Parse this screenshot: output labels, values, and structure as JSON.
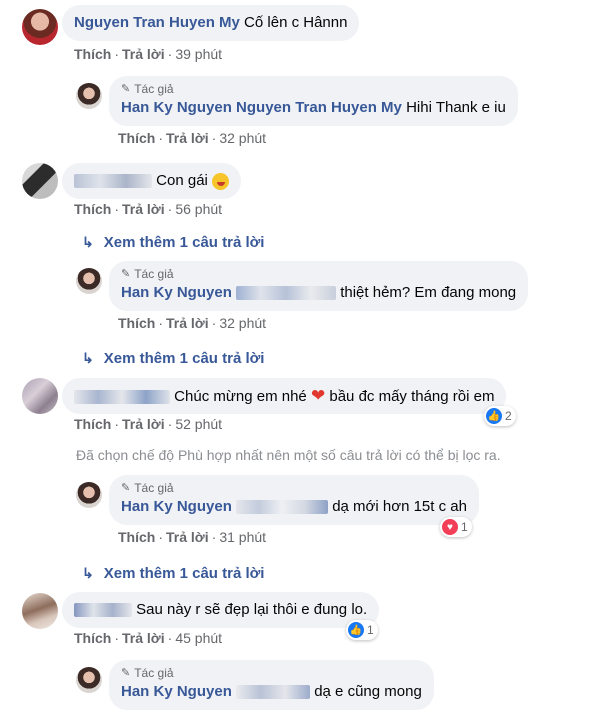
{
  "comments": [
    {
      "author": "Nguyen Tran Huyen My",
      "text": "Cố lên c Hânnn",
      "like": "Thích",
      "reply": "Trả lời",
      "time": "39 phút"
    },
    {
      "author_tag": "Tác giả",
      "author": "Han Ky Nguyen",
      "mention": "Nguyen Tran Huyen My",
      "text": "Hihi Thank e iu",
      "like": "Thích",
      "reply": "Trả lời",
      "time": "32 phút"
    },
    {
      "text": "Con gái",
      "like": "Thích",
      "reply": "Trả lời",
      "time": "56 phút",
      "more": "Xem thêm 1 câu trả lời"
    },
    {
      "author_tag": "Tác giả",
      "author": "Han Ky Nguyen",
      "text": "thiệt hẻm? Em đang mong",
      "like": "Thích",
      "reply": "Trả lời",
      "time": "32 phút",
      "more": "Xem thêm 1 câu trả lời"
    },
    {
      "text_a": "Chúc mừng em nhé",
      "text_b": "bầu đc mấy tháng rồi em",
      "like": "Thích",
      "reply": "Trả lời",
      "time": "52 phút",
      "reaction_count": "2"
    },
    {
      "filter_note": "Đã chọn chế độ Phù hợp nhất nên một số câu trả lời có thể bị lọc ra."
    },
    {
      "author_tag": "Tác giả",
      "author": "Han Ky Nguyen",
      "text": "dạ mới hơn 15t c ah",
      "like": "Thích",
      "reply": "Trả lời",
      "time": "31 phút",
      "reaction_count": "1",
      "more": "Xem thêm 1 câu trả lời"
    },
    {
      "text": "Sau này r sẽ đẹp lại thôi e đung lo.",
      "like": "Thích",
      "reply": "Trả lời",
      "time": "45 phút",
      "reaction_count": "1"
    },
    {
      "author_tag": "Tác giả",
      "author": "Han Ky Nguyen",
      "text": "dạ e cũng mong"
    }
  ],
  "colors": {
    "link": "#385898",
    "bubble": "#f0f2f5",
    "meta": "#65676b",
    "like_blue": "#1877f2",
    "love_red": "#f33e58"
  },
  "icons": [
    "pencil-icon",
    "reply-arrow-icon",
    "like-reaction-icon",
    "love-reaction-icon",
    "heart-emoji-icon",
    "tongue-emoji-icon"
  ]
}
